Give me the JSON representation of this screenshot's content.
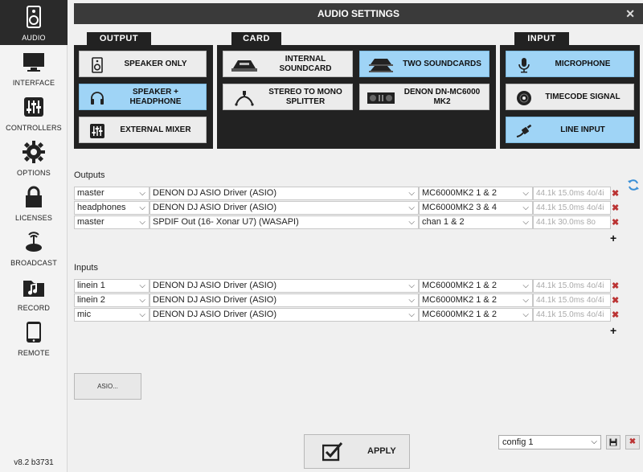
{
  "sidebar": {
    "items": [
      {
        "label": "AUDIO",
        "icon": "speaker-icon"
      },
      {
        "label": "INTERFACE",
        "icon": "monitor-icon"
      },
      {
        "label": "CONTROLLERS",
        "icon": "sliders-icon"
      },
      {
        "label": "OPTIONS",
        "icon": "gear-icon"
      },
      {
        "label": "LICENSES",
        "icon": "lock-icon"
      },
      {
        "label": "BROADCAST",
        "icon": "antenna-icon"
      },
      {
        "label": "RECORD",
        "icon": "music-folder-icon"
      },
      {
        "label": "REMOTE",
        "icon": "tablet-icon"
      }
    ],
    "version": "v8.2 b3731"
  },
  "title": "AUDIO SETTINGS",
  "close": "✕",
  "groups": {
    "output": {
      "label": "OUTPUT",
      "options": [
        "SPEAKER ONLY",
        "SPEAKER + HEADPHONE",
        "EXTERNAL MIXER"
      ],
      "selected": 1
    },
    "card": {
      "label": "CARD",
      "options": [
        "INTERNAL SOUNDCARD",
        "TWO SOUNDCARDS",
        "STEREO TO MONO SPLITTER",
        "DENON DN-MC6000 MK2"
      ],
      "selected": 1
    },
    "input": {
      "label": "INPUT",
      "options": [
        "MICROPHONE",
        "TIMECODE SIGNAL",
        "LINE INPUT"
      ],
      "selected": [
        0,
        2
      ]
    }
  },
  "outputs": {
    "label": "Outputs",
    "rows": [
      {
        "channel": "master",
        "driver": "DENON DJ ASIO Driver (ASIO)",
        "port": "MC6000MK2 1 & 2",
        "info": "44.1k 15.0ms 4o/4i"
      },
      {
        "channel": "headphones",
        "driver": "DENON DJ ASIO Driver (ASIO)",
        "port": "MC6000MK2 3 & 4",
        "info": "44.1k 15.0ms 4o/4i"
      },
      {
        "channel": "master",
        "driver": "SPDIF Out (16- Xonar U7) (WASAPI)",
        "port": "chan 1 & 2",
        "info": "44.1k 30.0ms 8o"
      }
    ]
  },
  "inputs": {
    "label": "Inputs",
    "rows": [
      {
        "channel": "linein 1",
        "driver": "DENON DJ ASIO Driver (ASIO)",
        "port": "MC6000MK2 1 & 2",
        "info": "44.1k 15.0ms 4o/4i"
      },
      {
        "channel": "linein 2",
        "driver": "DENON DJ ASIO Driver (ASIO)",
        "port": "MC6000MK2 1 & 2",
        "info": "44.1k 15.0ms 4o/4i"
      },
      {
        "channel": "mic",
        "driver": "DENON DJ ASIO Driver (ASIO)",
        "port": "MC6000MK2 1 & 2",
        "info": "44.1k 15.0ms 4o/4i"
      }
    ]
  },
  "asio_button": "ASIO...",
  "apply": "APPLY",
  "config": "config 1",
  "colors": {
    "selected": "#9fd4f6",
    "dark": "#222222",
    "delete": "#b33333"
  }
}
